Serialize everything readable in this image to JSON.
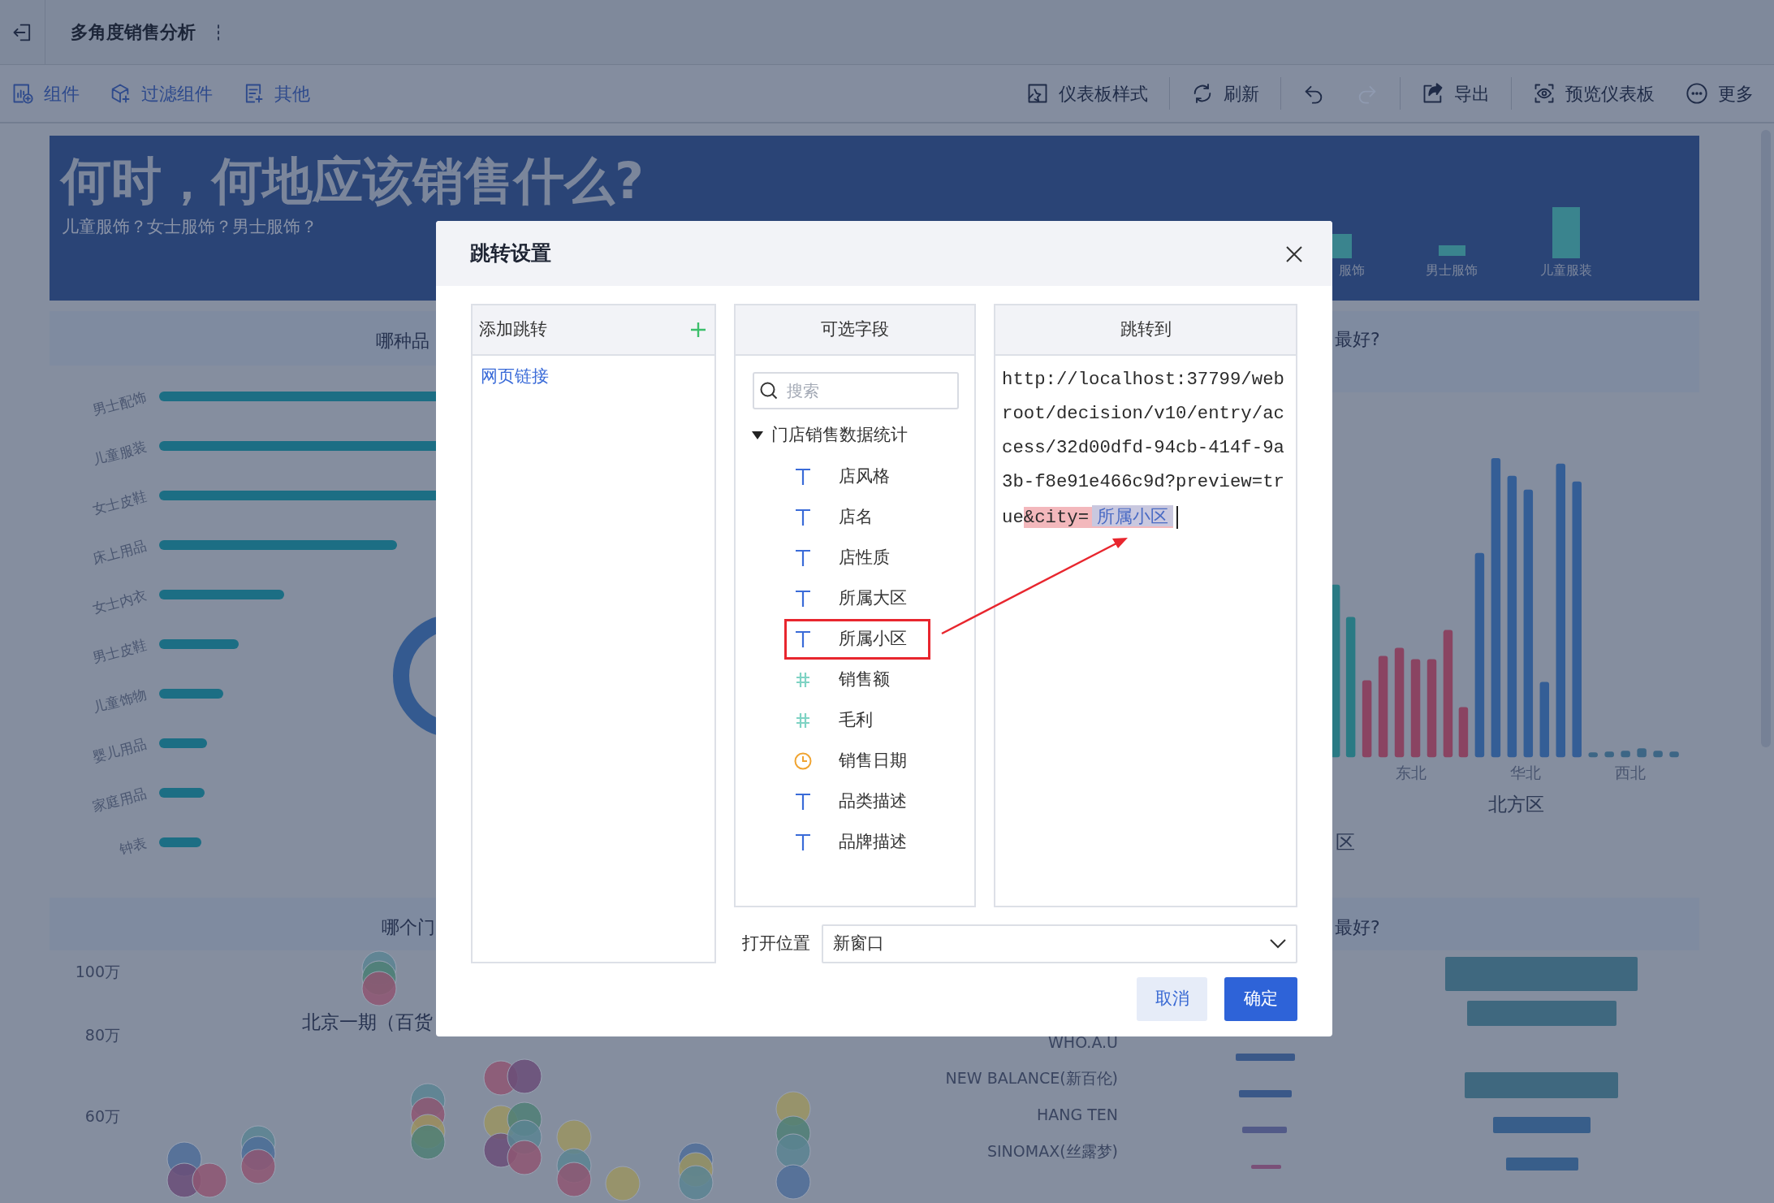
{
  "app_bar": {
    "title": "多角度销售分析"
  },
  "toolbar": {
    "left": [
      {
        "kind": "component",
        "label": "组件"
      },
      {
        "kind": "filter",
        "label": "过滤组件"
      },
      {
        "kind": "other",
        "label": "其他"
      }
    ],
    "right_groups": [
      [
        {
          "kind": "style",
          "label": "仪表板样式"
        }
      ],
      [
        {
          "kind": "refresh",
          "label": "刷新"
        }
      ],
      [
        {
          "kind": "undo",
          "disabled": false
        },
        {
          "kind": "redo",
          "disabled": true
        }
      ],
      [
        {
          "kind": "export",
          "label": "导出"
        }
      ],
      [
        {
          "kind": "preview",
          "label": "预览仪表板"
        },
        {
          "kind": "more",
          "label": "更多"
        }
      ]
    ]
  },
  "banner": {
    "title": "何时，何地应该销售什么?",
    "subtitle": "儿童服饰？女士服饰？男士服饰？",
    "legend": [
      "服饰",
      "男士服饰",
      "儿童服装"
    ]
  },
  "category_panel": {
    "title": "哪种品",
    "categories": [
      "男士配饰",
      "儿童服装",
      "女士皮鞋",
      "床上用品",
      "女士内衣",
      "男士皮鞋",
      "儿童饰物",
      "婴儿用品",
      "家庭用品",
      "钟表"
    ]
  },
  "region_panel": {
    "title": "最好?",
    "x_labels": [
      "东北",
      "华北",
      "西北"
    ],
    "group_label": "北方区",
    "partial_label": "区"
  },
  "store_panel": {
    "title": "哪个门",
    "y_labels": [
      "100万",
      "80万",
      "60万"
    ],
    "bubble_label": "北京一期（百货"
  },
  "brand_panel": {
    "title": "最好?",
    "brands": [
      "WHO.A.U",
      "NEW BALANCE(新百伦)",
      "HANG TEN",
      "SINOMAX(丝露梦)"
    ]
  },
  "dialog": {
    "title": "跳转设置",
    "jumps": {
      "header": "添加跳转",
      "items": [
        "网页链接"
      ]
    },
    "fields": {
      "header": "可选字段",
      "search_placeholder": "搜索",
      "group": {
        "label": "门店销售数据统计",
        "expanded": true,
        "children": [
          {
            "kind": "text",
            "label": "店风格",
            "annotated": false
          },
          {
            "kind": "text",
            "label": "店名",
            "annotated": false
          },
          {
            "kind": "text",
            "label": "店性质",
            "annotated": false
          },
          {
            "kind": "text",
            "label": "所属大区",
            "annotated": false
          },
          {
            "kind": "text",
            "label": "所属小区",
            "annotated": true
          },
          {
            "kind": "number",
            "label": "销售额",
            "annotated": false
          },
          {
            "kind": "number",
            "label": "毛利",
            "annotated": false
          },
          {
            "kind": "date",
            "label": "销售日期",
            "annotated": false
          },
          {
            "kind": "text",
            "label": "品类描述",
            "annotated": false
          },
          {
            "kind": "text",
            "label": "品牌描述",
            "annotated": false
          }
        ]
      }
    },
    "target": {
      "header": "跳转到",
      "url": "http://localhost:37799/webroot/decision/v10/entry/access/32d00dfd-94cb-414f-9a3b-f8e91e466c9d?preview=true",
      "param": "&city=",
      "field_tag": "所属小区"
    },
    "open_position": {
      "label": "打开位置",
      "value": "新窗口"
    },
    "buttons": [
      {
        "kind": "cancel",
        "label": "取消"
      },
      {
        "kind": "confirm",
        "label": "确定"
      }
    ]
  }
}
